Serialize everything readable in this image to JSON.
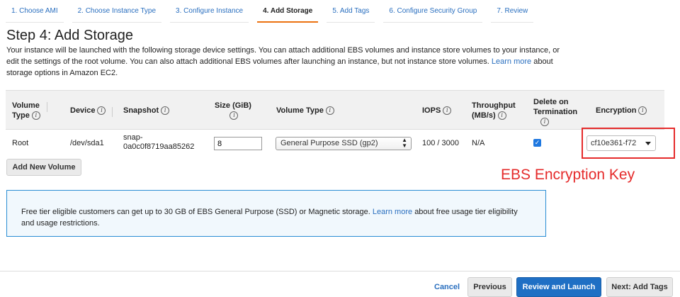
{
  "wizard_steps": [
    {
      "label": "1. Choose AMI",
      "active": false
    },
    {
      "label": "2. Choose Instance Type",
      "active": false
    },
    {
      "label": "3. Configure Instance",
      "active": false
    },
    {
      "label": "4. Add Storage",
      "active": true
    },
    {
      "label": "5. Add Tags",
      "active": false
    },
    {
      "label": "6. Configure Security Group",
      "active": false
    },
    {
      "label": "7. Review",
      "active": false
    }
  ],
  "title": "Step 4: Add Storage",
  "description": {
    "text": "Your instance will be launched with the following storage device settings. You can attach additional EBS volumes and instance store volumes to your instance, or edit the settings of the root volume. You can also attach additional EBS volumes after launching an instance, but not instance store volumes.",
    "link": "Learn more",
    "suffix": "about storage options in Amazon EC2."
  },
  "table": {
    "headers": {
      "volume_type_1": "Volume",
      "volume_type_2": "Type",
      "device": "Device",
      "snapshot": "Snapshot",
      "size_1": "Size (GiB)",
      "volume_type": "Volume Type",
      "iops": "IOPS",
      "throughput_1": "Throughput",
      "throughput_2": "(MB/s)",
      "delete_1": "Delete on",
      "delete_2": "Termination",
      "encryption": "Encryption"
    },
    "info_glyph": "i",
    "row": {
      "volume_type": "Root",
      "device": "/dev/sda1",
      "snapshot_1": "snap-",
      "snapshot_2": "0a0c0f8719aa85262",
      "size": "8",
      "ebs_type": "General Purpose SSD (gp2)",
      "iops": "100 / 3000",
      "throughput": "N/A",
      "delete_on_termination": true,
      "encryption_key": "cf10e361-f72"
    }
  },
  "add_volume_label": "Add New Volume",
  "callout": "EBS Encryption Key",
  "notice": {
    "text": "Free tier eligible customers can get up to 30 GB of EBS General Purpose (SSD) or Magnetic storage.",
    "link": "Learn more",
    "suffix": "about free usage tier eligibility and usage restrictions."
  },
  "footer": {
    "cancel": "Cancel",
    "previous": "Previous",
    "review": "Review and Launch",
    "next": "Next: Add Tags"
  },
  "colors": {
    "accent_blue": "#1f6fc4",
    "link_blue": "#2a6fbf",
    "active_tab_orange": "#ec7211",
    "callout_red": "#e52b2b"
  }
}
